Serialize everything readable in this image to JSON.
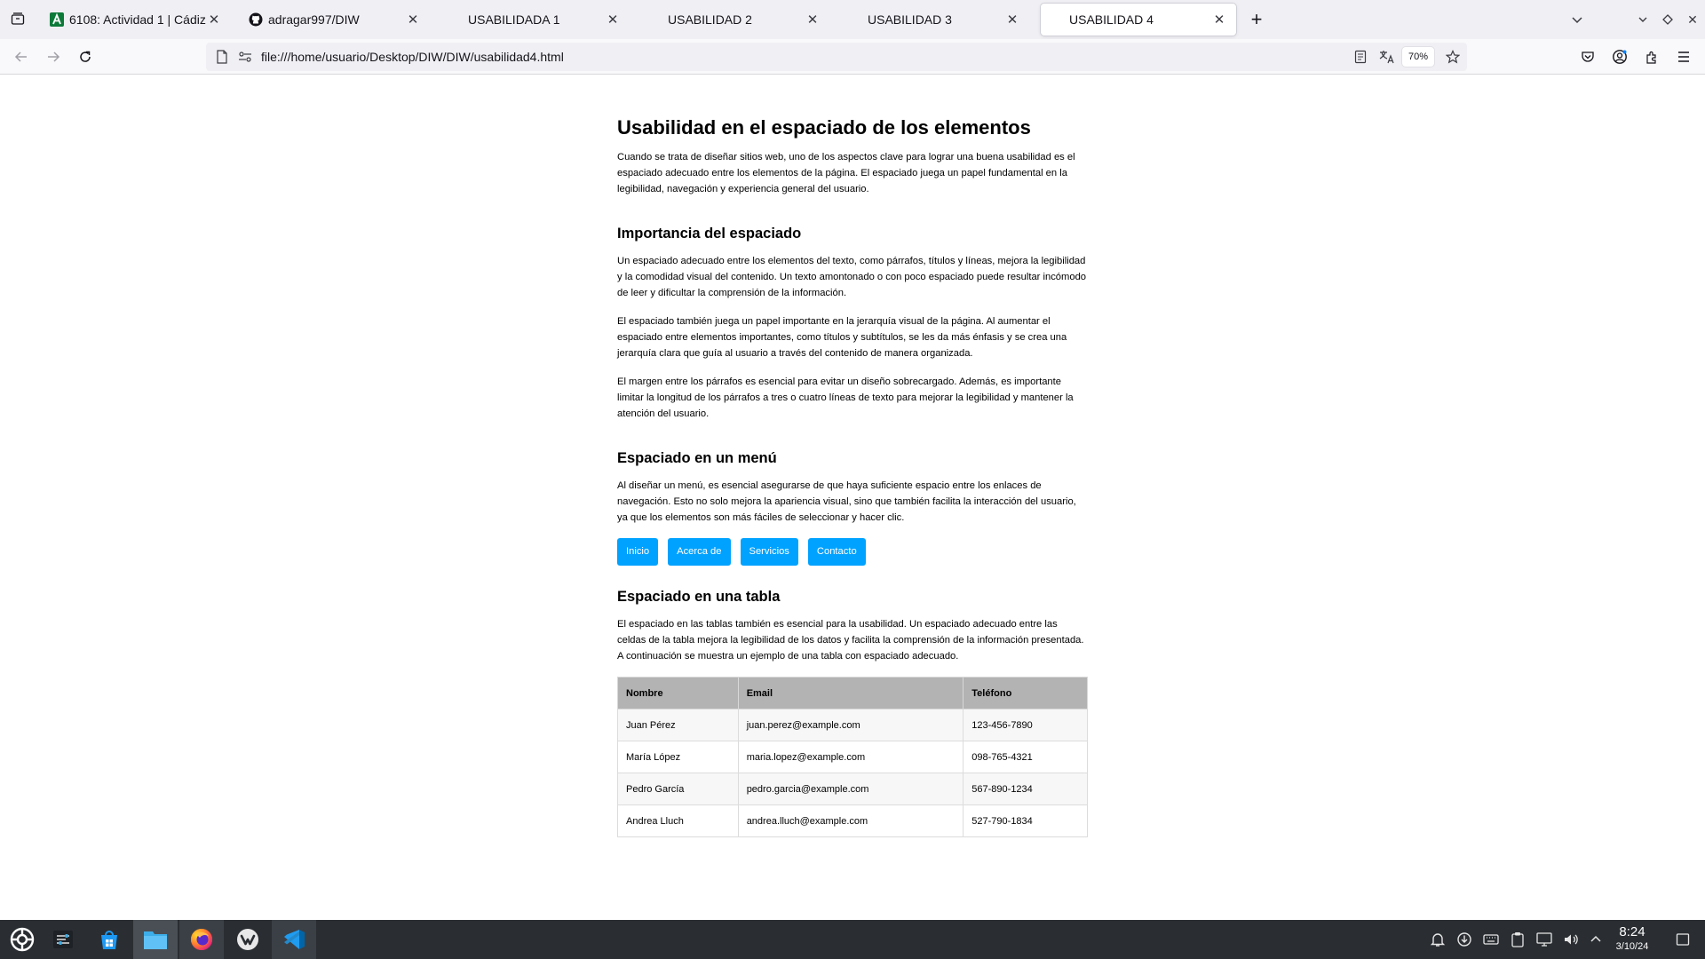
{
  "browser": {
    "tabs": [
      {
        "label": "6108: Actividad 1 | Cádiz",
        "favicon": "a-green-icon",
        "active": false
      },
      {
        "label": "adragar997/DIW",
        "favicon": "github-icon",
        "active": false
      },
      {
        "label": "USABILIDADA 1",
        "favicon": "",
        "active": false
      },
      {
        "label": "USABILIDAD 2",
        "favicon": "",
        "active": false
      },
      {
        "label": "USABILIDAD 3",
        "favicon": "",
        "active": false
      },
      {
        "label": "USABILIDAD 4",
        "favicon": "",
        "active": true
      }
    ],
    "url": "file:///home/usuario/Desktop/DIW/DIW/usabilidad4.html",
    "zoom": "70%"
  },
  "page": {
    "title": "Usabilidad en el espaciado de los elementos",
    "intro": "Cuando se trata de diseñar sitios web, uno de los aspectos clave para lograr una buena usabilidad es el espaciado adecuado entre los elementos de la página. El espaciado juega un papel fundamental en la legibilidad, navegación y experiencia general del usuario.",
    "section1": {
      "heading": "Importancia del espaciado",
      "p1": "Un espaciado adecuado entre los elementos del texto, como párrafos, títulos y líneas, mejora la legibilidad y la comodidad visual del contenido. Un texto amontonado o con poco espaciado puede resultar incómodo de leer y dificultar la comprensión de la información.",
      "p2": "El espaciado también juega un papel importante en la jerarquía visual de la página. Al aumentar el espaciado entre elementos importantes, como títulos y subtítulos, se les da más énfasis y se crea una jerarquía clara que guía al usuario a través del contenido de manera organizada.",
      "p3": "El margen entre los párrafos es esencial para evitar un diseño sobrecargado. Además, es importante limitar la longitud de los párrafos a tres o cuatro líneas de texto para mejorar la legibilidad y mantener la atención del usuario."
    },
    "section2": {
      "heading": "Espaciado en un menú",
      "p1": "Al diseñar un menú, es esencial asegurarse de que haya suficiente espacio entre los enlaces de navegación. Esto no solo mejora la apariencia visual, sino que también facilita la interacción del usuario, ya que los elementos son más fáciles de seleccionar y hacer clic.",
      "menu": [
        "Inicio",
        "Acerca de",
        "Servicios",
        "Contacto"
      ]
    },
    "section3": {
      "heading": "Espaciado en una tabla",
      "p1": "El espaciado en las tablas también es esencial para la usabilidad. Un espaciado adecuado entre las celdas de la tabla mejora la legibilidad de los datos y facilita la comprensión de la información presentada. A continuación se muestra un ejemplo de una tabla con espaciado adecuado.",
      "table": {
        "headers": [
          "Nombre",
          "Email",
          "Teléfono"
        ],
        "rows": [
          [
            "Juan Pérez",
            "juan.perez@example.com",
            "123-456-7890"
          ],
          [
            "María López",
            "maria.lopez@example.com",
            "098-765-4321"
          ],
          [
            "Pedro García",
            "pedro.garcia@example.com",
            "567-890-1234"
          ],
          [
            "Andrea Lluch",
            "andrea.lluch@example.com",
            "527-790-1834"
          ]
        ]
      }
    }
  },
  "taskbar": {
    "time": "8:24",
    "date": "3/10/24",
    "apps": [
      "app-launcher-icon",
      "system-settings-icon",
      "discover-store-icon",
      "file-manager-icon",
      "firefox-icon",
      "vivaldi-icon",
      "vscode-icon"
    ]
  },
  "colors": {
    "menu_button": "#00a2ff",
    "table_header": "#b3b3b3",
    "taskbar": "#2a2e32"
  }
}
